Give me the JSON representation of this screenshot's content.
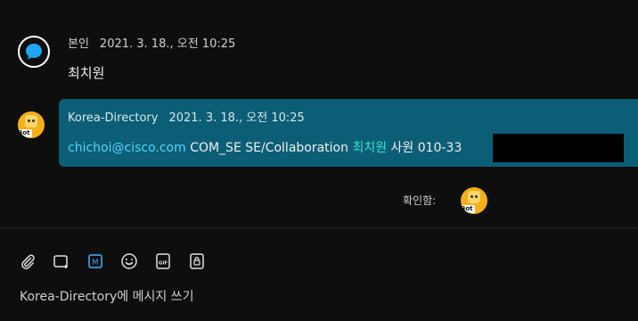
{
  "message_self": {
    "sender": "본인",
    "timestamp": "2021. 3. 18., 오전 10:25",
    "text": "최치원"
  },
  "message_bot": {
    "sender": "Korea-Directory",
    "timestamp": "2021. 3. 18., 오전 10:25",
    "email": "chichoi@cisco.com",
    "org": "COM_SE SE/Collaboration",
    "name": "최치원",
    "title": "사원",
    "phone": "010-33",
    "avatar_tag": "Bot"
  },
  "read_receipt": {
    "label": "확인함:",
    "avatar_tag": "Bot"
  },
  "toolbar": {
    "icons": [
      "paperclip-icon",
      "screenshot-icon",
      "markdown-icon",
      "emoji-icon",
      "gif-icon",
      "lock-icon"
    ],
    "markdown_glyph": "M",
    "gif_glyph": "GIF"
  },
  "composer": {
    "placeholder": "Korea-Directory에 메시지 쓰기"
  },
  "colors": {
    "background": "#0e0e0f",
    "highlight": "#0c5e76",
    "link": "#4fd5ff",
    "bot_avatar": "#f3b019",
    "markdown_active": "#3fb4ff"
  }
}
